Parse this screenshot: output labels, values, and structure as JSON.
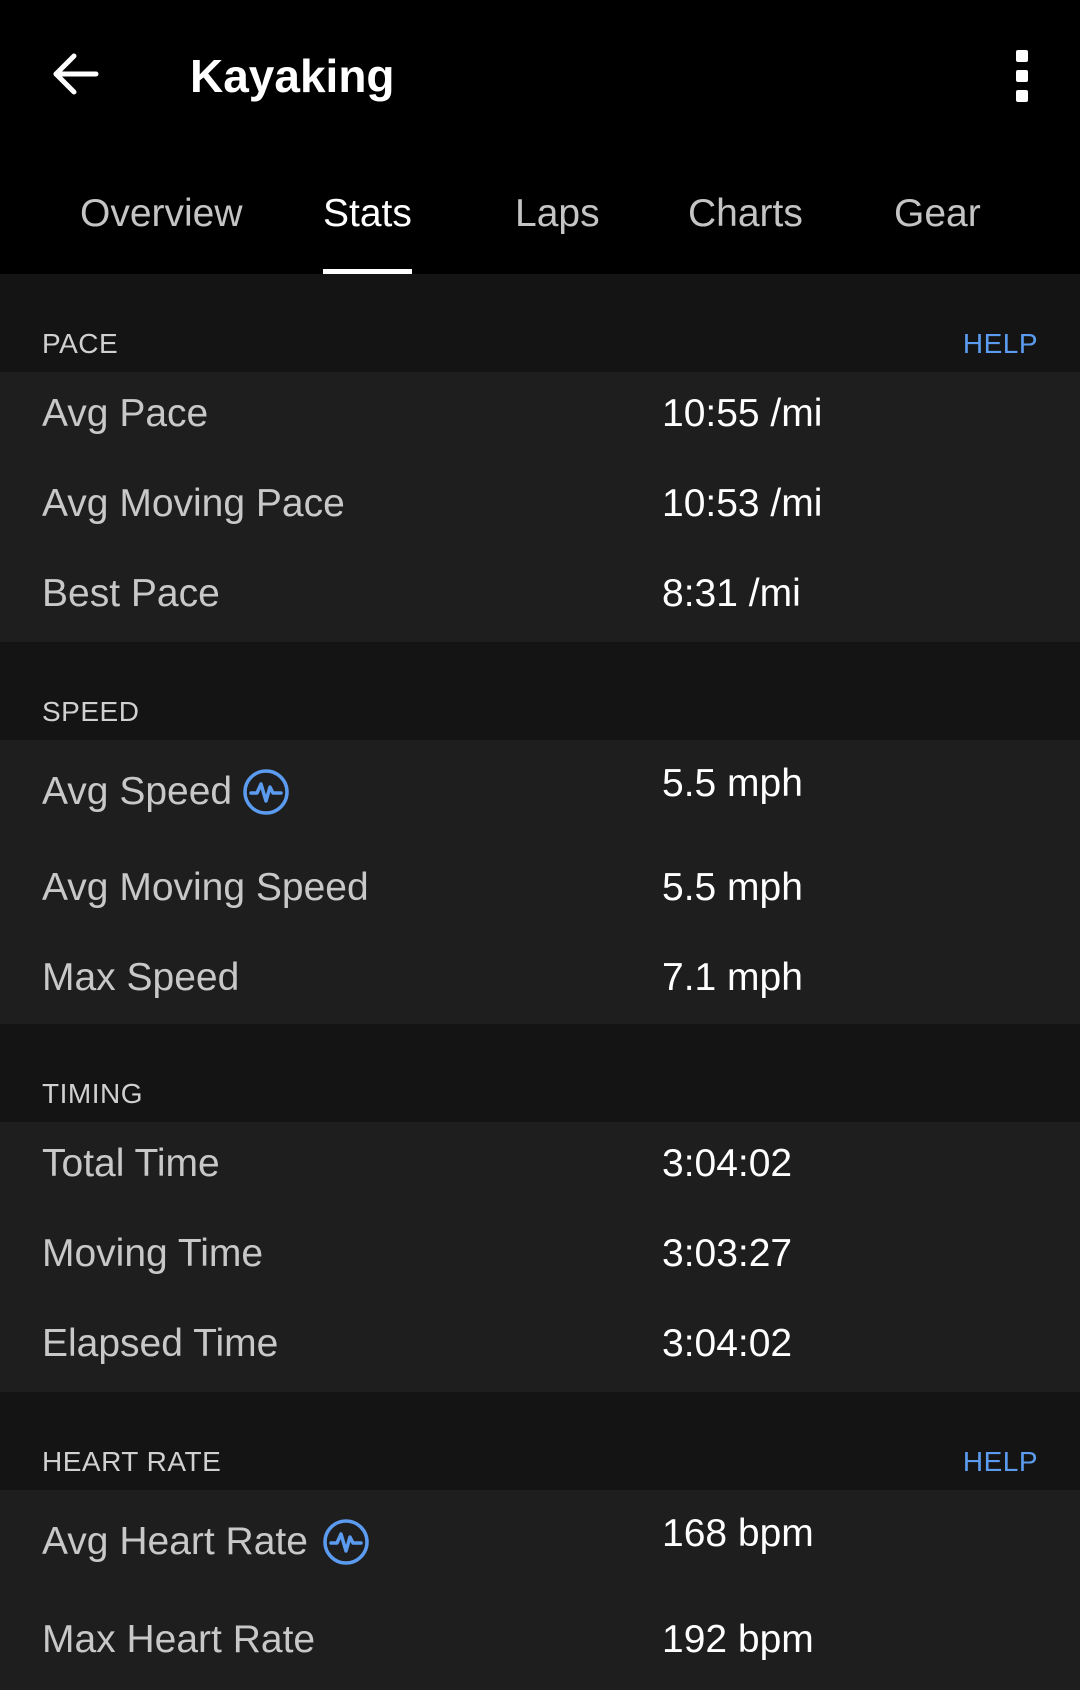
{
  "header": {
    "title": "Kayaking",
    "back_icon": "arrow-left-icon",
    "menu_icon": "more-vertical-icon"
  },
  "tabs": [
    {
      "label": "Overview",
      "active": false
    },
    {
      "label": "Stats",
      "active": true
    },
    {
      "label": "Laps",
      "active": false
    },
    {
      "label": "Charts",
      "active": false
    },
    {
      "label": "Gear",
      "active": false
    }
  ],
  "colors": {
    "accent": "#5b9cf0",
    "background": "#000000",
    "section_bg": "#1e1e1e",
    "divider_bg": "#141414"
  },
  "sections": {
    "pace": {
      "title": "PACE",
      "help": "HELP",
      "rows": [
        {
          "label": "Avg Pace",
          "value": "10:55 /mi"
        },
        {
          "label": "Avg Moving Pace",
          "value": "10:53 /mi"
        },
        {
          "label": "Best Pace",
          "value": "8:31 /mi"
        }
      ]
    },
    "speed": {
      "title": "SPEED",
      "rows": [
        {
          "label": "Avg Speed",
          "value": "5.5 mph",
          "icon": "pulse-icon"
        },
        {
          "label": "Avg Moving Speed",
          "value": "5.5 mph"
        },
        {
          "label": "Max Speed",
          "value": "7.1 mph"
        }
      ]
    },
    "timing": {
      "title": "TIMING",
      "rows": [
        {
          "label": "Total Time",
          "value": "3:04:02"
        },
        {
          "label": "Moving Time",
          "value": "3:03:27"
        },
        {
          "label": "Elapsed Time",
          "value": "3:04:02"
        }
      ]
    },
    "heart_rate": {
      "title": "HEART RATE",
      "help": "HELP",
      "rows": [
        {
          "label": "Avg Heart Rate",
          "value": "168 bpm",
          "icon": "pulse-icon"
        },
        {
          "label": "Max Heart Rate",
          "value": "192 bpm"
        }
      ]
    }
  }
}
